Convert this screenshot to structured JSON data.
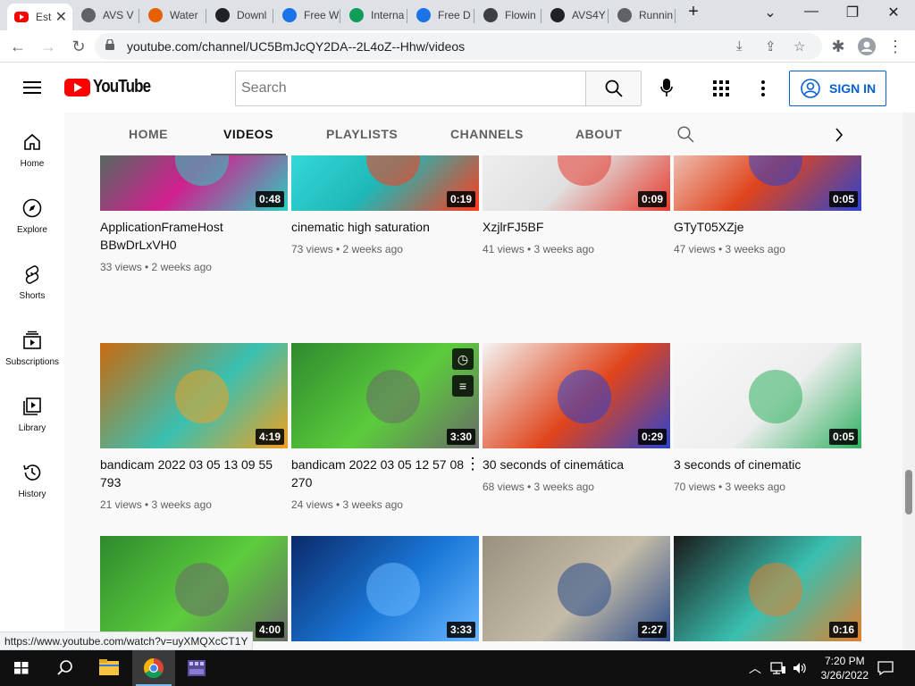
{
  "browser": {
    "tabs": [
      {
        "label": "Est",
        "icon": "youtube-icon",
        "color": "#ff0000"
      },
      {
        "label": "AVS V",
        "icon": "globe-icon",
        "color": "#5f6368"
      },
      {
        "label": "Water",
        "icon": "firefox-icon",
        "color": "#e66000"
      },
      {
        "label": "Downl",
        "icon": "m-icon",
        "color": "#202124"
      },
      {
        "label": "Free W",
        "icon": "play-circle-icon",
        "color": "#1a73e8"
      },
      {
        "label": "Interna",
        "icon": "play-triangle-icon",
        "color": "#0f9d58"
      },
      {
        "label": "Free D",
        "icon": "play-circle-icon",
        "color": "#1a73e8"
      },
      {
        "label": "Flowin",
        "icon": "arrows-icon",
        "color": "#3c4043"
      },
      {
        "label": "AVS4Y",
        "icon": "number-icon",
        "color": "#202124"
      },
      {
        "label": "Runnin",
        "icon": "music-note-icon",
        "color": "#5f6368"
      }
    ],
    "url": "youtube.com/channel/UC5BmJcQY2DA--2L4oZ--Hhw/videos",
    "status_url": "https://www.youtube.com/watch?v=uyXMQXcCT1Y"
  },
  "masthead": {
    "brand": "YouTube",
    "search_placeholder": "Search",
    "signin_label": "SIGN IN"
  },
  "sidebar": {
    "items": [
      {
        "label": "Home",
        "icon": "home-icon"
      },
      {
        "label": "Explore",
        "icon": "compass-icon"
      },
      {
        "label": "Shorts",
        "icon": "shorts-icon"
      },
      {
        "label": "Subscriptions",
        "icon": "subscriptions-icon"
      },
      {
        "label": "Library",
        "icon": "library-icon"
      },
      {
        "label": "History",
        "icon": "history-icon"
      }
    ]
  },
  "channel_tabs": [
    "HOME",
    "VIDEOS",
    "PLAYLISTS",
    "CHANNELS",
    "ABOUT"
  ],
  "videos": [
    {
      "title": "ApplicationFrameHost BBwDrLxVH0",
      "duration": "0:48",
      "meta": "33 views • 2 weeks ago",
      "colors": [
        "#1f8a4c",
        "#d0208f",
        "#2ad0c0"
      ]
    },
    {
      "title": "cinematic high saturation",
      "duration": "0:19",
      "meta": "73 views • 2 weeks ago",
      "colors": [
        "#3ee6e6",
        "#1fb8b8",
        "#ff3a1a"
      ]
    },
    {
      "title": "XzjlrFJ5BF",
      "duration": "0:09",
      "meta": "41 views • 3 weeks ago",
      "colors": [
        "#f4f4f4",
        "#e0e0e0",
        "#e63b2e"
      ]
    },
    {
      "title": "GTyT05XZje",
      "duration": "0:05",
      "meta": "47 views • 3 weeks ago",
      "colors": [
        "#f4f4f4",
        "#e0441c",
        "#2a44d0"
      ]
    },
    {
      "title": "bandicam 2022 03 05 13 09 55 793",
      "duration": "4:19",
      "meta": "21 views • 3 weeks ago",
      "colors": [
        "#c86a10",
        "#3ac0b0",
        "#f0a020"
      ]
    },
    {
      "title": "bandicam 2022 03 05 12 57 08 270",
      "duration": "3:30",
      "meta": "24 views • 3 weeks ago",
      "colors": [
        "#2e8a2e",
        "#5ccc3c",
        "#6a6a6a"
      ]
    },
    {
      "title": "30 seconds of cinemática",
      "duration": "0:29",
      "meta": "68 views • 3 weeks ago",
      "colors": [
        "#f4f4f4",
        "#e0441c",
        "#2a44d0"
      ]
    },
    {
      "title": "3 seconds of cinematic",
      "duration": "0:05",
      "meta": "70 views • 3 weeks ago",
      "colors": [
        "#f8f8f8",
        "#eeeeee",
        "#30b060"
      ]
    },
    {
      "title": "",
      "duration": "4:00",
      "meta": "",
      "colors": [
        "#2e8a2e",
        "#5ccc3c",
        "#6a6a6a"
      ]
    },
    {
      "title": "",
      "duration": "3:33",
      "meta": "",
      "colors": [
        "#0a2a6a",
        "#1a78d8",
        "#6ab8ff"
      ]
    },
    {
      "title": "",
      "duration": "2:27",
      "meta": "",
      "colors": [
        "#9a9080",
        "#c4bca8",
        "#2a4a8a"
      ]
    },
    {
      "title": "",
      "duration": "0:16",
      "meta": "",
      "colors": [
        "#1a1a1a",
        "#3ac0b0",
        "#e08030"
      ]
    }
  ],
  "taskbar": {
    "time": "7:20 PM",
    "date": "3/26/2022"
  }
}
